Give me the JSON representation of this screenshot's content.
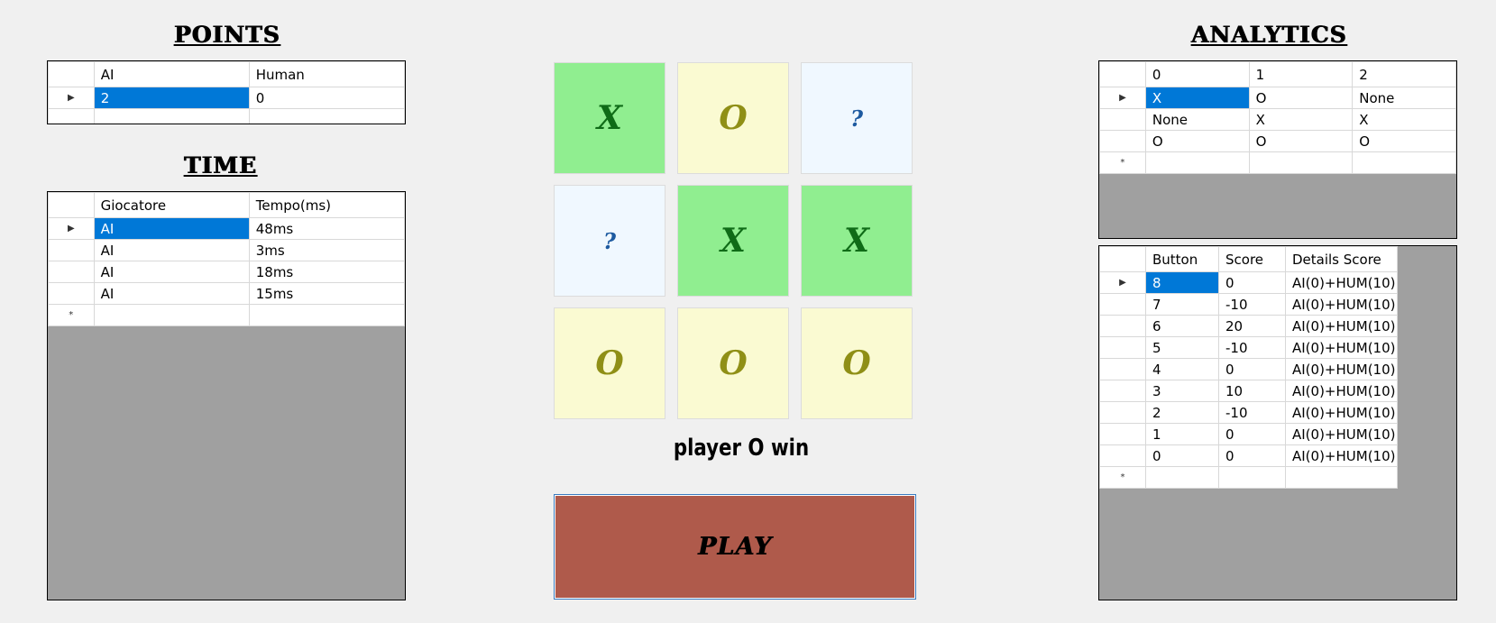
{
  "points": {
    "title": "POINTS",
    "columns": [
      "AI",
      "Human"
    ],
    "rows": [
      [
        "2",
        "0"
      ]
    ]
  },
  "time": {
    "title": "TIME",
    "columns": [
      "Giocatore",
      "Tempo(ms)"
    ],
    "rows": [
      [
        "AI",
        "48ms"
      ],
      [
        "AI",
        "3ms"
      ],
      [
        "AI",
        "18ms"
      ],
      [
        "AI",
        "15ms"
      ]
    ]
  },
  "analytics": {
    "title": "ANALYTICS",
    "board": {
      "columns": [
        "0",
        "1",
        "2"
      ],
      "rows": [
        [
          "X",
          "O",
          "None"
        ],
        [
          "None",
          "X",
          "X"
        ],
        [
          "O",
          "O",
          "O"
        ]
      ]
    },
    "scores": {
      "columns": [
        "Button",
        "Score",
        "Details Score"
      ],
      "rows": [
        [
          "8",
          "0",
          "AI(0)+HUM(10)"
        ],
        [
          "7",
          "-10",
          "AI(0)+HUM(10)"
        ],
        [
          "6",
          "20",
          "AI(0)+HUM(10)"
        ],
        [
          "5",
          "-10",
          "AI(0)+HUM(10)"
        ],
        [
          "4",
          "0",
          "AI(0)+HUM(10)"
        ],
        [
          "3",
          "10",
          "AI(0)+HUM(10)"
        ],
        [
          "2",
          "-10",
          "AI(0)+HUM(10)"
        ],
        [
          "1",
          "0",
          "AI(0)+HUM(10)"
        ],
        [
          "0",
          "0",
          "AI(0)+HUM(10)"
        ]
      ]
    }
  },
  "board": {
    "cells": [
      "X",
      "O",
      "?",
      "?",
      "X",
      "X",
      "O",
      "O",
      "O"
    ]
  },
  "status": "player O win",
  "play_label": "PLAY",
  "glyphs": {
    "current_row": "▶",
    "new_row": "*"
  },
  "icons": {
    "current_row": "current-row-arrow-icon",
    "new_row": "new-row-asterisk-icon"
  },
  "colors": {
    "x_cell": "#90ee90",
    "o_cell": "#fafad2",
    "empty_cell": "#f0f8ff",
    "play_button": "#af5a4b",
    "selection": "#0078d7",
    "grid_background": "#a0a0a0"
  }
}
